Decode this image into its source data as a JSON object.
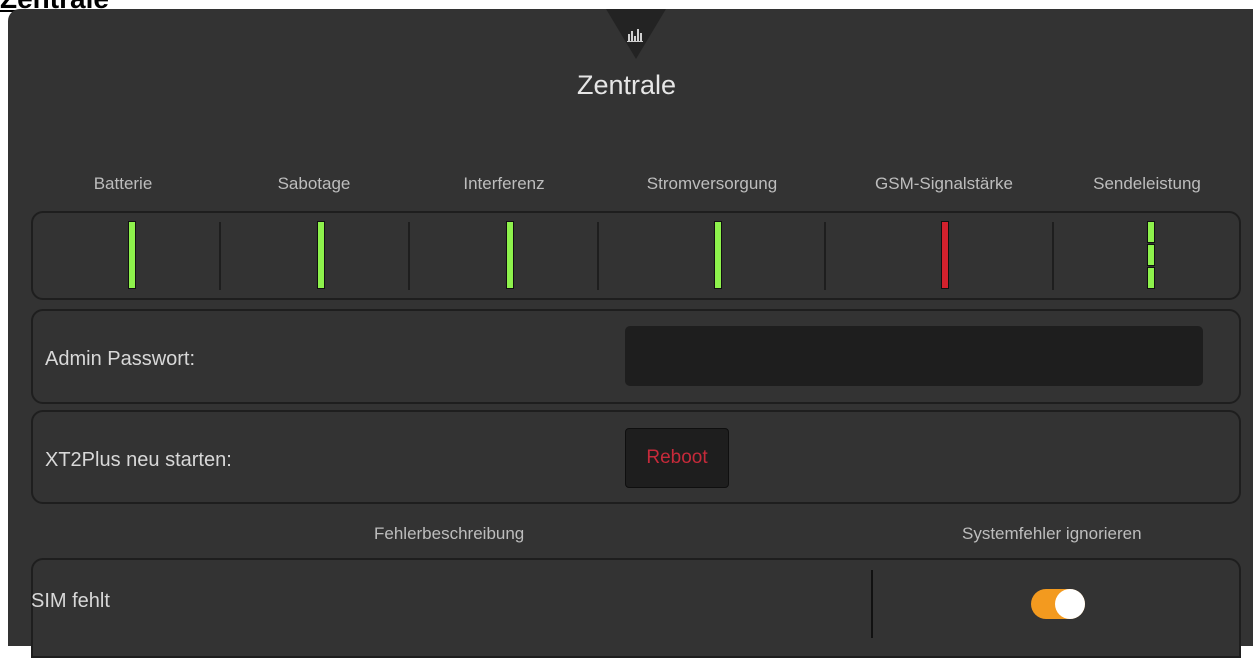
{
  "page_heading": "Zentrale",
  "panel": {
    "title": "Zentrale",
    "tab_icon": "bar-chart-icon"
  },
  "status": {
    "items": [
      {
        "label": "Batterie",
        "color": "#8ef24c",
        "state": "ok"
      },
      {
        "label": "Sabotage",
        "color": "#8ef24c",
        "state": "ok"
      },
      {
        "label": "Interferenz",
        "color": "#8ef24c",
        "state": "ok"
      },
      {
        "label": "Stromversorgung",
        "color": "#8ef24c",
        "state": "ok"
      },
      {
        "label": "GSM-Signalstärke",
        "color": "#d3212d",
        "state": "error"
      },
      {
        "label": "Sendeleistung",
        "color": "#8ef24c",
        "state": "ok",
        "segments": 3
      }
    ]
  },
  "admin": {
    "label": "Admin Passwort:",
    "value": ""
  },
  "reboot": {
    "label": "XT2Plus neu starten:",
    "button": "Reboot"
  },
  "errors": {
    "header_description": "Fehlerbeschreibung",
    "header_ignore": "Systemfehler ignorieren",
    "rows": [
      {
        "description": "SIM fehlt",
        "ignored": true
      }
    ]
  },
  "colors": {
    "ok": "#8ef24c",
    "error": "#d3212d",
    "toggle_on": "#f39a1f",
    "reboot_text": "#c62a3a"
  }
}
